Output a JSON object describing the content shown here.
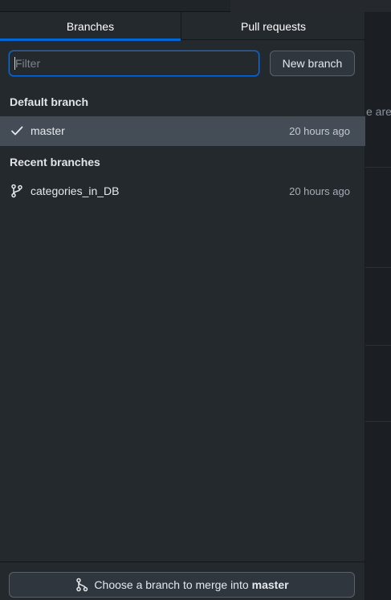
{
  "tabs": [
    {
      "label": "Branches",
      "active": true
    },
    {
      "label": "Pull requests",
      "active": false
    }
  ],
  "filter": {
    "placeholder": "Filter",
    "value": ""
  },
  "new_branch_label": "New branch",
  "default_section": {
    "header": "Default branch",
    "branch": {
      "name": "master",
      "time": "20 hours ago",
      "icon": "check-icon",
      "selected": true
    }
  },
  "recent_section": {
    "header": "Recent branches",
    "branches": [
      {
        "name": "categories_in_DB",
        "time": "20 hours ago",
        "icon": "branch-icon"
      }
    ]
  },
  "footer": {
    "merge_prefix": "Choose a branch to merge into",
    "merge_target": "master",
    "icon": "merge-branch-icon"
  },
  "background": {
    "partial_text": "e are s"
  },
  "colors": {
    "accent": "#0366d6",
    "panel_bg": "#24292e",
    "selected_row": "#444d56"
  }
}
